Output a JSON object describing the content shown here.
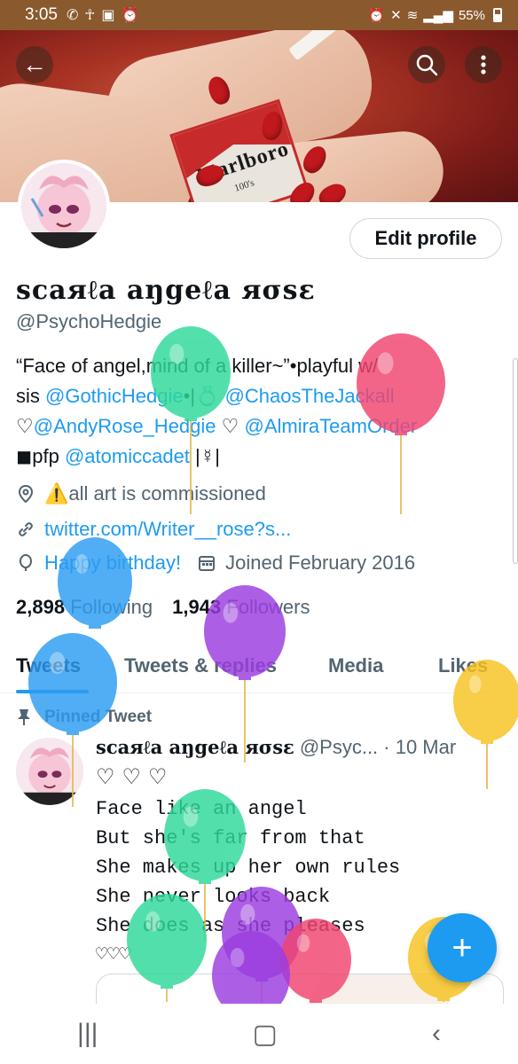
{
  "status_bar": {
    "time": "3:05",
    "battery": "55%",
    "left_icons": [
      "messenger-icon",
      "ankh-icon",
      "twitch-icon",
      "alarm-icon"
    ],
    "right_icons": [
      "alarm-icon",
      "mute-icon",
      "wifi-icon",
      "signal-icon"
    ]
  },
  "banner": {
    "pack_brand": "Marlboro",
    "pack_sub": "100's"
  },
  "profile": {
    "edit_label": "Edit profile",
    "display_name": "scaяℓa aŋgeℓa яσsɛ",
    "handle": "@PsychoHedgie",
    "bio": {
      "line1_text": "“Face of angel,mind of a killer~”•playful w/",
      "line2_prefix": "sis ",
      "line2_link1": "@GothicHedgie",
      "line2_mid": "•|💍 ",
      "line2_link2": "@ChaosTheJackall",
      "line3_prefix": "♡",
      "line3_link1": "@AndyRose_Hedgie",
      "line3_mid": " ♡ ",
      "line3_link2": "@AlmiraTeamOrder",
      "line4_prefix": "◼pfp ",
      "line4_link": "@atomiccadet",
      "line4_suffix": " |☿|"
    },
    "location": "⚠️all art is commissioned",
    "website": "twitter.com/Writer__rose?s...",
    "birthday": "Happy birthday!",
    "joined": "Joined February 2016",
    "following_count": "2,898",
    "following_label": "Following",
    "followers_count": "1,943",
    "followers_label": "Followers"
  },
  "tabs": [
    "Tweets",
    "Tweets & replies",
    "Media",
    "Likes"
  ],
  "pinned": {
    "label": "Pinned Tweet",
    "name": "scaяℓa aŋgeℓa яσsɛ",
    "handle_time": "@Psyc... · 10 Mar",
    "hearts": "♡♡♡",
    "lines": [
      "Face like an angel",
      "But she's far from that",
      "She makes up her own rules",
      "She never looks back",
      "She does as she pleases"
    ],
    "bottom_hearts": "♡♡♡"
  },
  "fab_label": "+",
  "colors": {
    "accent": "#1d9bf0",
    "status_bar": "#8a5a2e"
  },
  "balloons": [
    {
      "color": "#2ed99a"
    },
    {
      "color": "#f04470"
    },
    {
      "color": "#2c9cf2"
    },
    {
      "color": "#9b3ce0"
    },
    {
      "color": "#2c9cf2"
    },
    {
      "color": "#f7c31f"
    },
    {
      "color": "#2ed99a"
    },
    {
      "color": "#9b3ce0"
    },
    {
      "color": "#2ed99a"
    },
    {
      "color": "#f04470"
    },
    {
      "color": "#9b3ce0"
    },
    {
      "color": "#f7c31f"
    }
  ]
}
